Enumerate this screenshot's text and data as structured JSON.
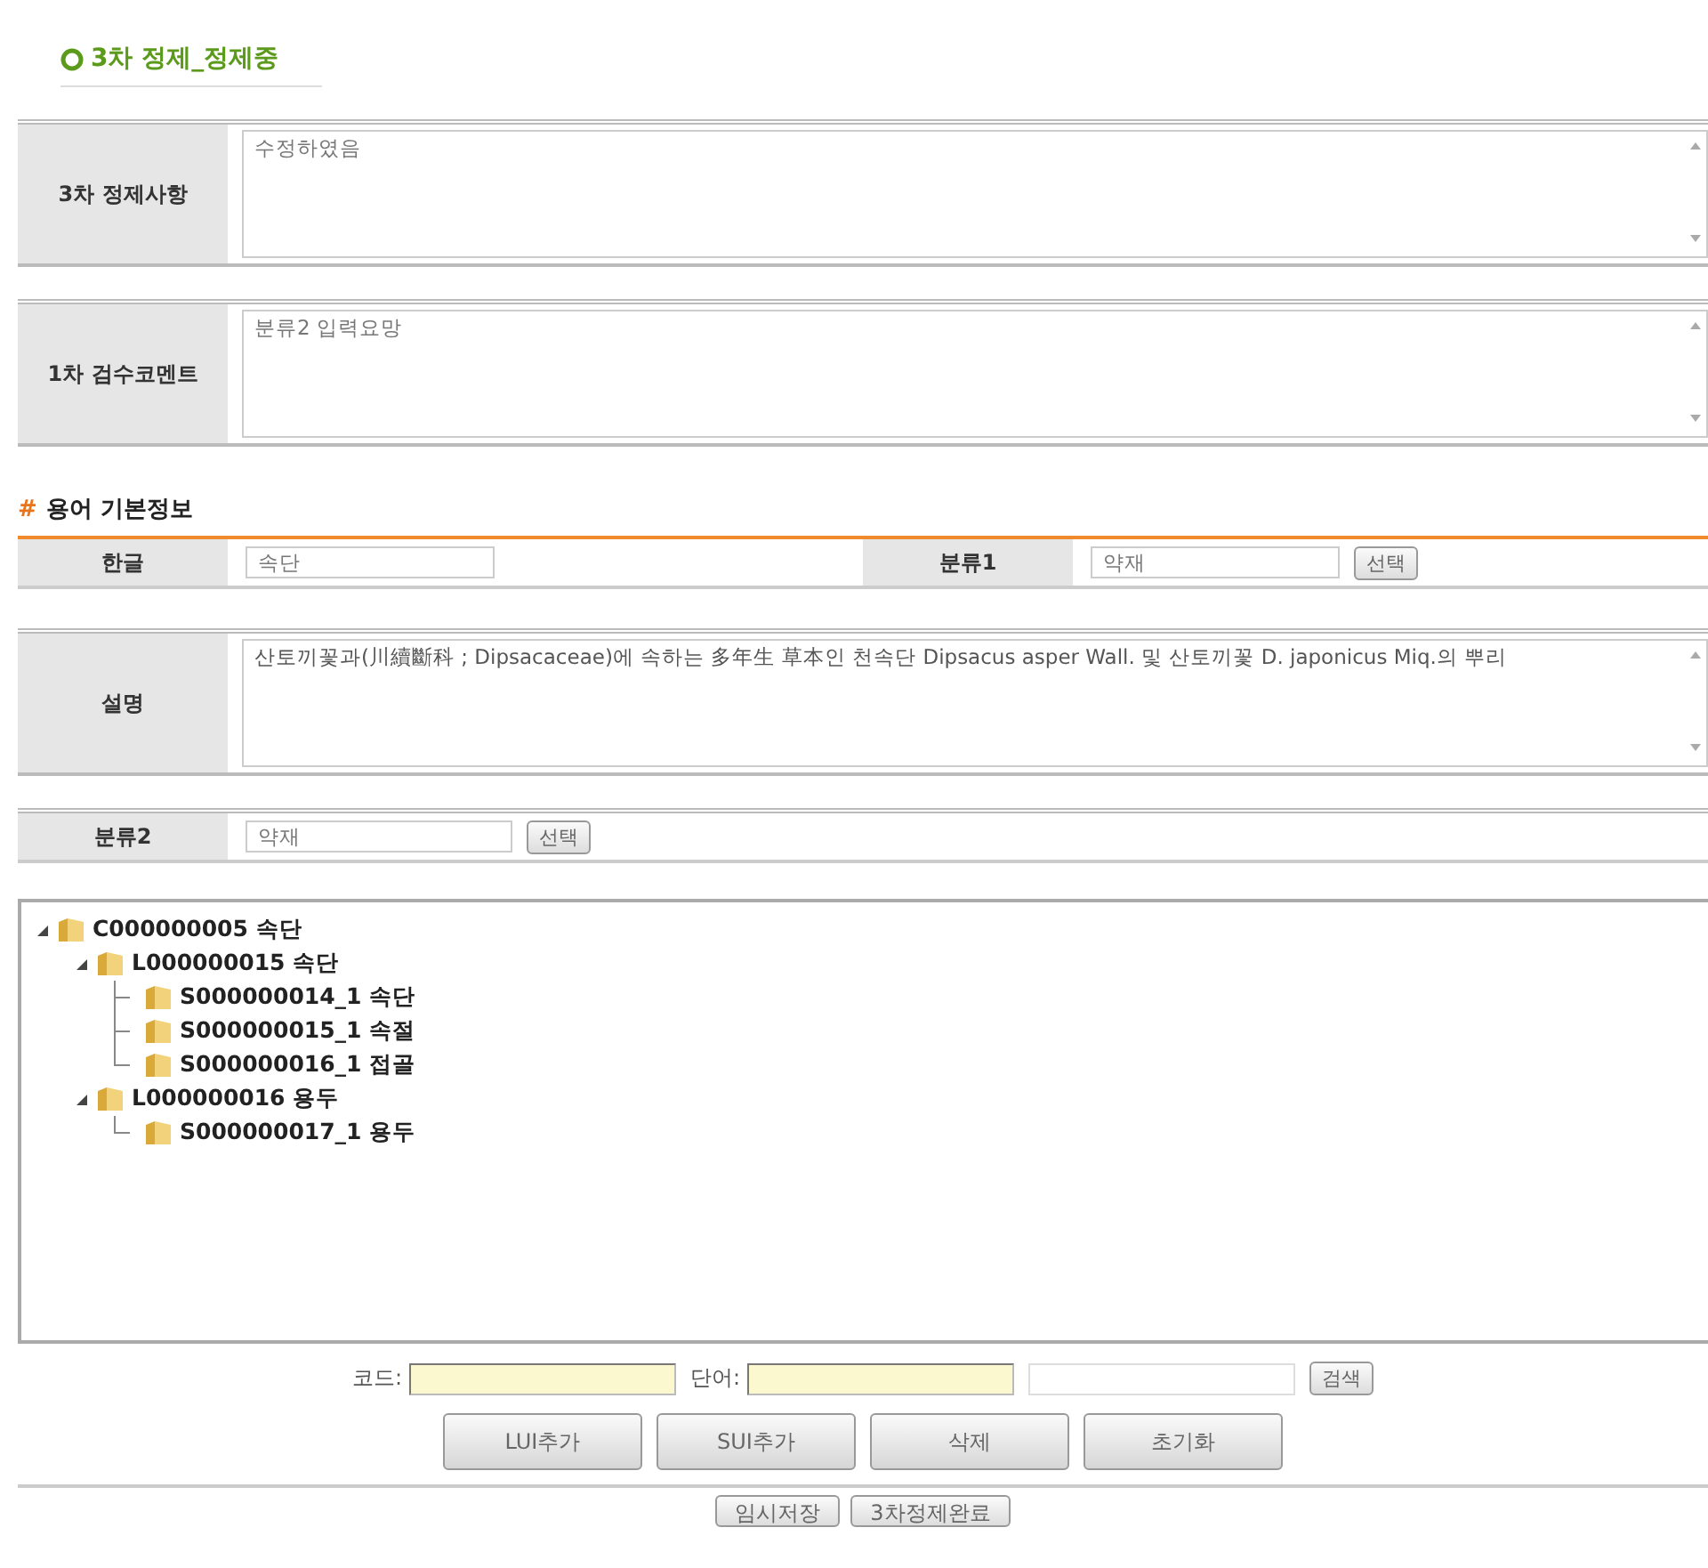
{
  "title": "3차 정제_정제중",
  "review_fields": [
    {
      "label": "3차 정제사항",
      "value": "수정하였음"
    },
    {
      "label": "1차 검수코멘트",
      "value": "분류2 입력요망"
    }
  ],
  "section_heading": {
    "mark": "#",
    "title": "용어 기본정보"
  },
  "basic_info": {
    "hangul": {
      "label": "한글",
      "value": "속단"
    },
    "category1": {
      "label": "분류1",
      "value": "약재",
      "button": "선택"
    },
    "description": {
      "label": "설명",
      "value": "산토끼꽃과(川續斷科 ; Dipsacaceae)에 속하는 多年生 草本인 천속단 Dipsacus asper Wall. 및 산토끼꽃 D. japonicus Miq.의 뿌리"
    },
    "category2": {
      "label": "분류2",
      "value": "약재",
      "button": "선택"
    }
  },
  "tree": [
    {
      "label": "C000000005 속단",
      "expanded": true,
      "children": [
        {
          "label": "L000000015 속단",
          "expanded": true,
          "children": [
            {
              "label": "S000000014_1 속단"
            },
            {
              "label": "S000000015_1 속절"
            },
            {
              "label": "S000000016_1 접골"
            }
          ]
        },
        {
          "label": "L000000016 용두",
          "expanded": true,
          "children": [
            {
              "label": "S000000017_1 용두"
            }
          ]
        }
      ]
    }
  ],
  "search": {
    "code_label": "코드:",
    "word_label": "단어:",
    "button": "검색"
  },
  "actions": [
    "LUI추가",
    "SUI추가",
    "삭제",
    "초기화"
  ],
  "footer_buttons": [
    "임시저장",
    "3차정제완료"
  ]
}
